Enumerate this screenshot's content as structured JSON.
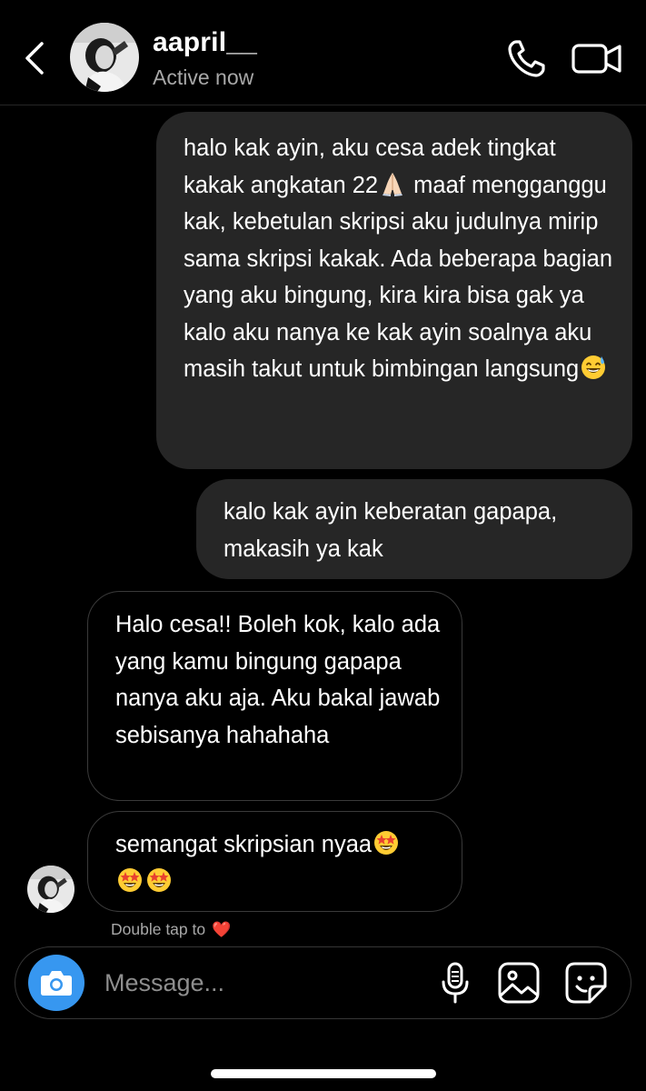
{
  "header": {
    "name": "aapril__",
    "status": "Active now",
    "back_icon": "chevron-left-icon",
    "call_icon": "phone-icon",
    "video_icon": "video-camera-icon"
  },
  "messages": [
    {
      "direction": "sent",
      "parts": [
        "halo kak ayin, aku cesa adek tingkat kakak angkatan 22",
        "folded-hands-emoji",
        " maaf mengganggu kak, kebetulan skripsi aku judulnya mirip sama skripsi kakak. Ada beberapa bagian yang aku bingung, kira kira bisa gak ya kalo aku nanya ke kak ayin soalnya aku masih takut untuk bimbingan langsung",
        "grinning-sweat-emoji"
      ],
      "text_1": "halo kak ayin, aku cesa adek tingkat kakak angkatan 22",
      "text_2": " maaf mengganggu kak, kebetulan skripsi aku judulnya mirip sama skripsi kakak. Ada beberapa bagian yang aku bingung, kira kira bisa gak ya kalo aku nanya ke kak ayin soalnya aku masih takut untuk bimbingan langsung"
    },
    {
      "direction": "sent",
      "text": "kalo kak ayin keberatan gapapa, makasih ya kak"
    },
    {
      "direction": "received",
      "text": "Halo cesa!! Boleh kok, kalo ada yang kamu bingung gapapa nanya aku aja. Aku bakal jawab sebisanya hahahaha"
    },
    {
      "direction": "received",
      "text": "semangat skripsian nyaa",
      "trailing_emoji": "star-struck-emoji x3"
    }
  ],
  "reaction_hint": {
    "text": "Double tap to",
    "emoji": "❤️"
  },
  "composer": {
    "placeholder": "Message...",
    "camera_icon": "camera-icon",
    "mic_icon": "microphone-icon",
    "gallery_icon": "image-icon",
    "sticker_icon": "sticker-icon"
  },
  "colors": {
    "background": "#000000",
    "sent_bubble": "#262626",
    "received_border": "#3a3a3a",
    "camera_button": "#3797f0",
    "secondary_text": "#a8a8a8"
  }
}
